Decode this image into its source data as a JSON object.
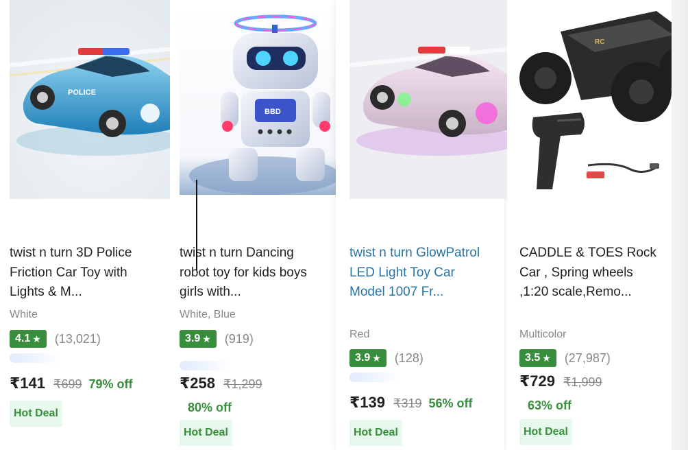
{
  "products": [
    {
      "title": "twist n turn 3D Police Friction Car Toy with Lights & M...",
      "variant": "White",
      "rating": "4.1",
      "rating_count": "(13,021)",
      "price": "₹141",
      "mrp": "₹699",
      "discount": "79% off",
      "deal": "Hot Deal",
      "image": "blue-police-car-toy"
    },
    {
      "title": "twist n turn Dancing robot toy for kids boys girls with...",
      "variant": "White, Blue",
      "rating": "3.9",
      "rating_count": "(919)",
      "price": "₹258",
      "mrp": "₹1,299",
      "discount": "80% off",
      "deal": "Hot Deal",
      "image": "dancing-robot-toy"
    },
    {
      "title": "twist n turn GlowPatrol LED Light Toy Car Model 1007 Fr...",
      "variant": "Red",
      "rating": "3.9",
      "rating_count": "(128)",
      "price": "₹139",
      "mrp": "₹319",
      "discount": "56% off",
      "deal": "Hot Deal",
      "image": "led-police-car-toy"
    },
    {
      "title": "CADDLE & TOES Rock Car , Spring wheels ,1:20 scale,Remo...",
      "variant": "Multicolor",
      "rating": "3.5",
      "rating_count": "(27,987)",
      "price": "₹729",
      "mrp": "₹1,999",
      "discount": "63% off",
      "deal": "Hot Deal",
      "image": "rc-rock-crawler-car"
    }
  ],
  "star_glyph": "★",
  "colors": {
    "rating_green": "#388e3c",
    "deal_bg": "#e7f8ec",
    "link_blue": "#2874a6",
    "muted": "#878787"
  }
}
